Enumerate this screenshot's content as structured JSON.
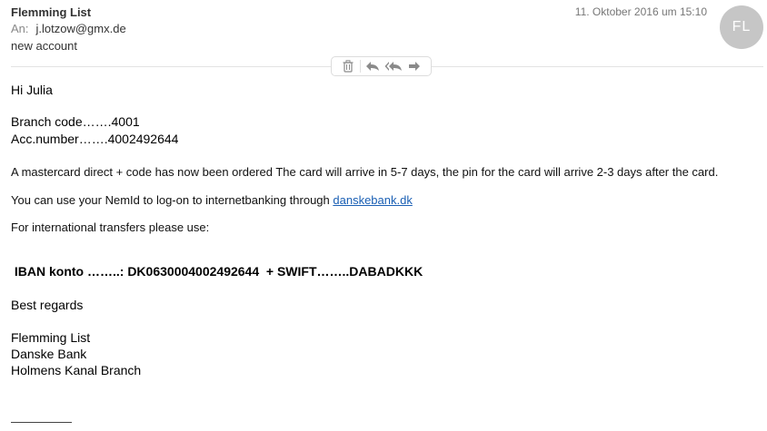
{
  "header": {
    "sender": "Flemming List",
    "to_label": "An:",
    "to_address": "j.lotzow@gmx.de",
    "subject": "new account",
    "date": "11. Oktober 2016 um 15:10",
    "avatar_initials": "FL"
  },
  "toolbar": {
    "icons": [
      "trash-icon",
      "reply-icon",
      "reply-all-icon",
      "forward-icon"
    ]
  },
  "body": {
    "greeting": "Hi Julia",
    "branch_code": "Branch code…….4001",
    "acc_number": "Acc.number…….4002492644",
    "card_text": "A  mastercard direct + code has now been ordered The card will arrive in 5-7 days, the pin for the card will arrive 2-3 days after the card.",
    "nemid_prefix": "You can use your NemId to log-on to internetbanking through ",
    "nemid_link": "danskebank.dk",
    "intl_text": "For international transfers please use:",
    "iban_line": " IBAN konto ……..: DK0630004002492644  + SWIFT……..DABADKKK",
    "regards": "Best regards",
    "sig_name": "Flemming List",
    "sig_bank": "Danske Bank",
    "sig_branch": "Holmens Kanal Branch"
  },
  "colors": {
    "link": "#1a5fb4",
    "avatar_bg": "#c6c6c6"
  }
}
